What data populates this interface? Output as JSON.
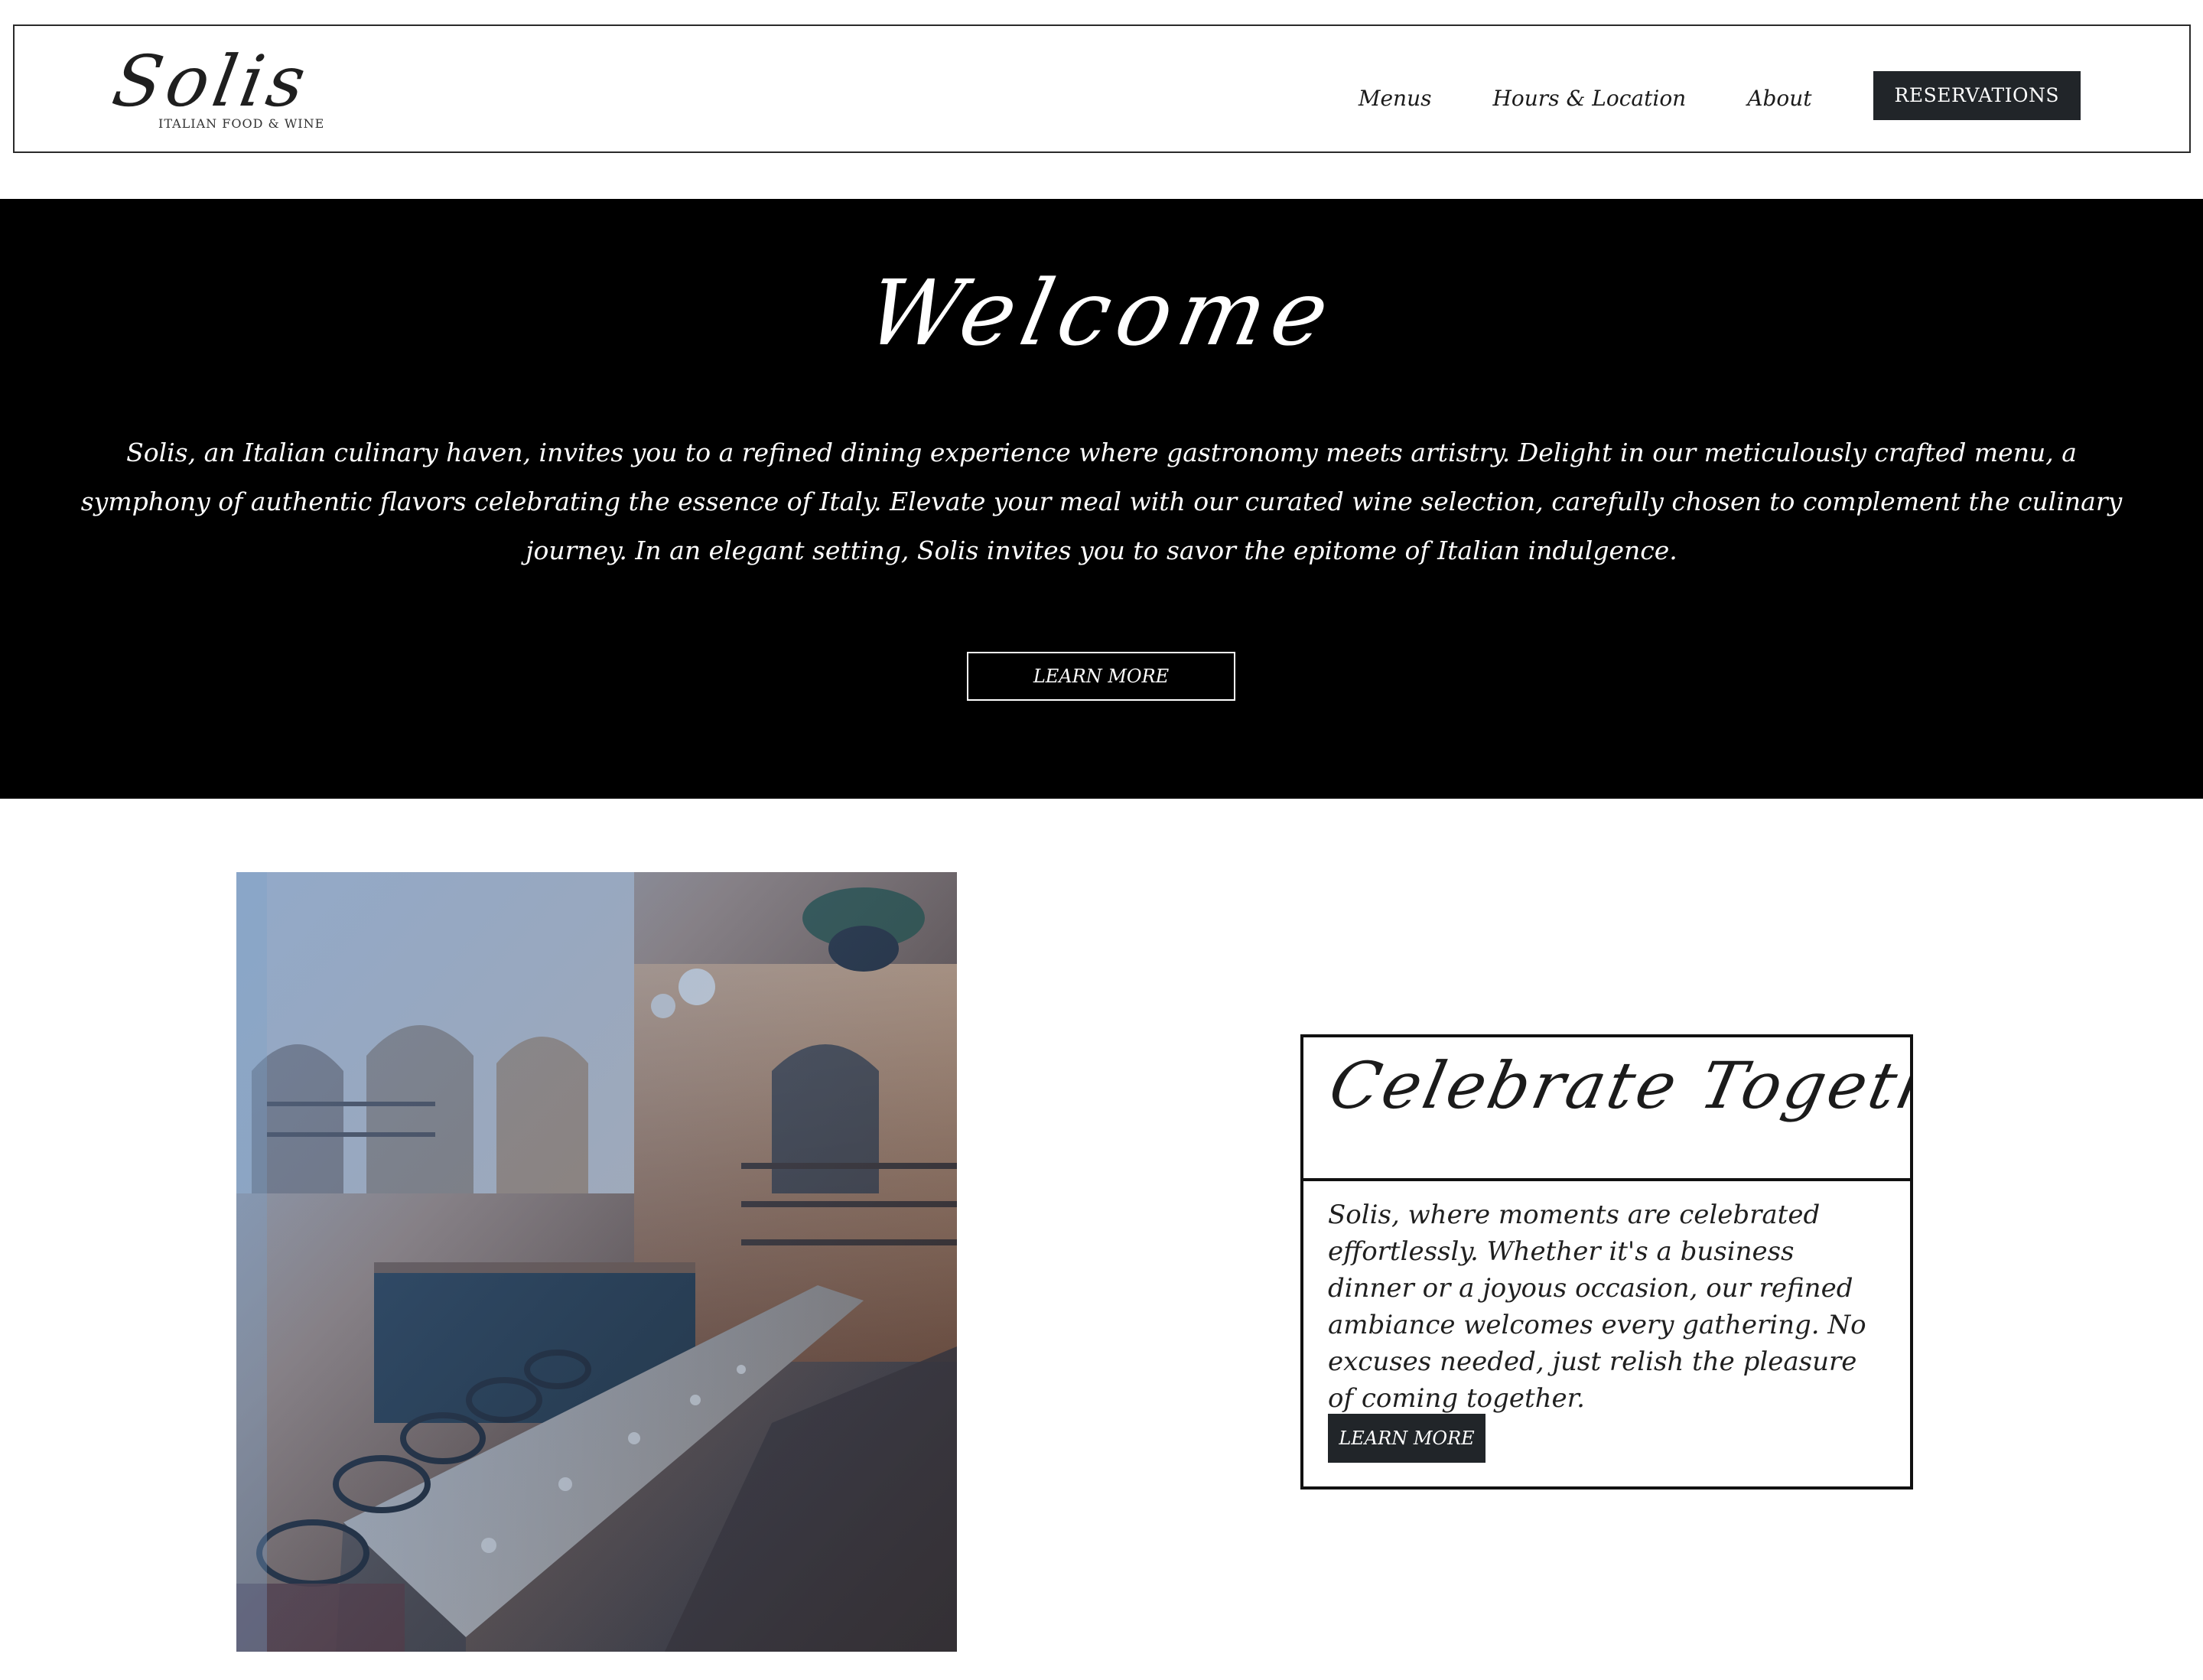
{
  "header": {
    "logo_name": "Solis",
    "logo_tagline": "ITALIAN FOOD & WINE",
    "nav": [
      "Menus",
      "Hours & Location",
      "About"
    ],
    "reservations_label": "RESERVATIONS"
  },
  "hero": {
    "title": "Welcome",
    "text": "Solis, an Italian culinary haven, invites you to a refined dining experience where gastronomy meets artistry. Delight in our meticulously crafted menu, a symphony of authentic flavors celebrating the essence of Italy. Elevate your meal with our curated wine selection, carefully chosen to complement the culinary journey. In an elegant setting, Solis invites you to savor the epitome of Italian indulgence.",
    "button_label": "LEARN MORE"
  },
  "feature": {
    "title": "Celebrate Together",
    "text": "Solis, where moments are celebrated effortlessly. Whether it's a business dinner or a joyous occasion, our refined ambiance welcomes every gathering. No excuses needed, just relish the pleasure of coming together.",
    "button_label": "LEARN MORE"
  },
  "icons": {
    "photo": "restaurant-interior-image"
  }
}
